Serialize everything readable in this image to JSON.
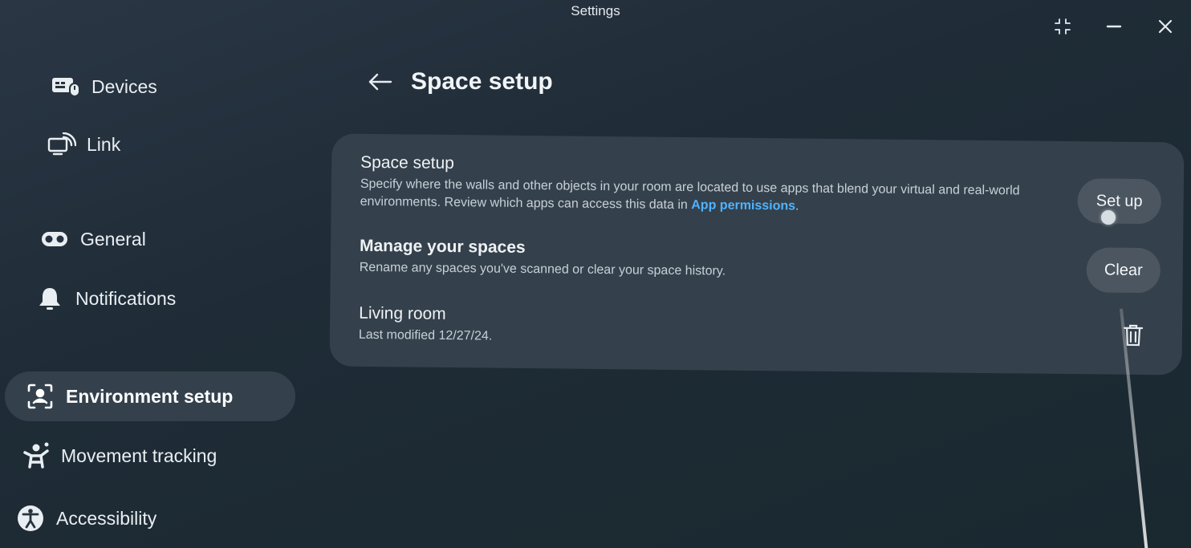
{
  "window": {
    "title": "Settings",
    "controls": [
      "collapse-icon",
      "minimize-icon",
      "close-icon"
    ]
  },
  "sidebar": {
    "items": [
      {
        "label": "Devices",
        "icon": "devices-icon"
      },
      {
        "label": "Link",
        "icon": "link-icon"
      },
      {
        "label": "General",
        "icon": "headset-icon"
      },
      {
        "label": "Notifications",
        "icon": "bell-icon"
      },
      {
        "label": "Environment setup",
        "icon": "environment-icon",
        "active": true
      },
      {
        "label": "Movement tracking",
        "icon": "person-icon"
      },
      {
        "label": "Accessibility",
        "icon": "accessibility-icon"
      }
    ]
  },
  "header": {
    "back_icon": "arrow-left-icon",
    "title": "Space setup"
  },
  "card": {
    "space_setup": {
      "title": "Space setup",
      "description": "Specify where the walls and other objects in your room are located to use apps that blend your virtual and real-world environments. Review which apps can access this data in ",
      "link_text": "App permissions",
      "description_end": ".",
      "button_label": "Set up"
    },
    "manage": {
      "title": "Manage your spaces",
      "description": "Rename any spaces you've scanned or clear your space history.",
      "button_label": "Clear"
    },
    "space": {
      "name": "Living room",
      "modified": "Last modified 12/27/24.",
      "delete_icon": "trash-icon"
    }
  },
  "colors": {
    "background": "#1f2c37",
    "card": "#34404b",
    "active_item": "#34414d",
    "link": "#4fb3ff"
  }
}
